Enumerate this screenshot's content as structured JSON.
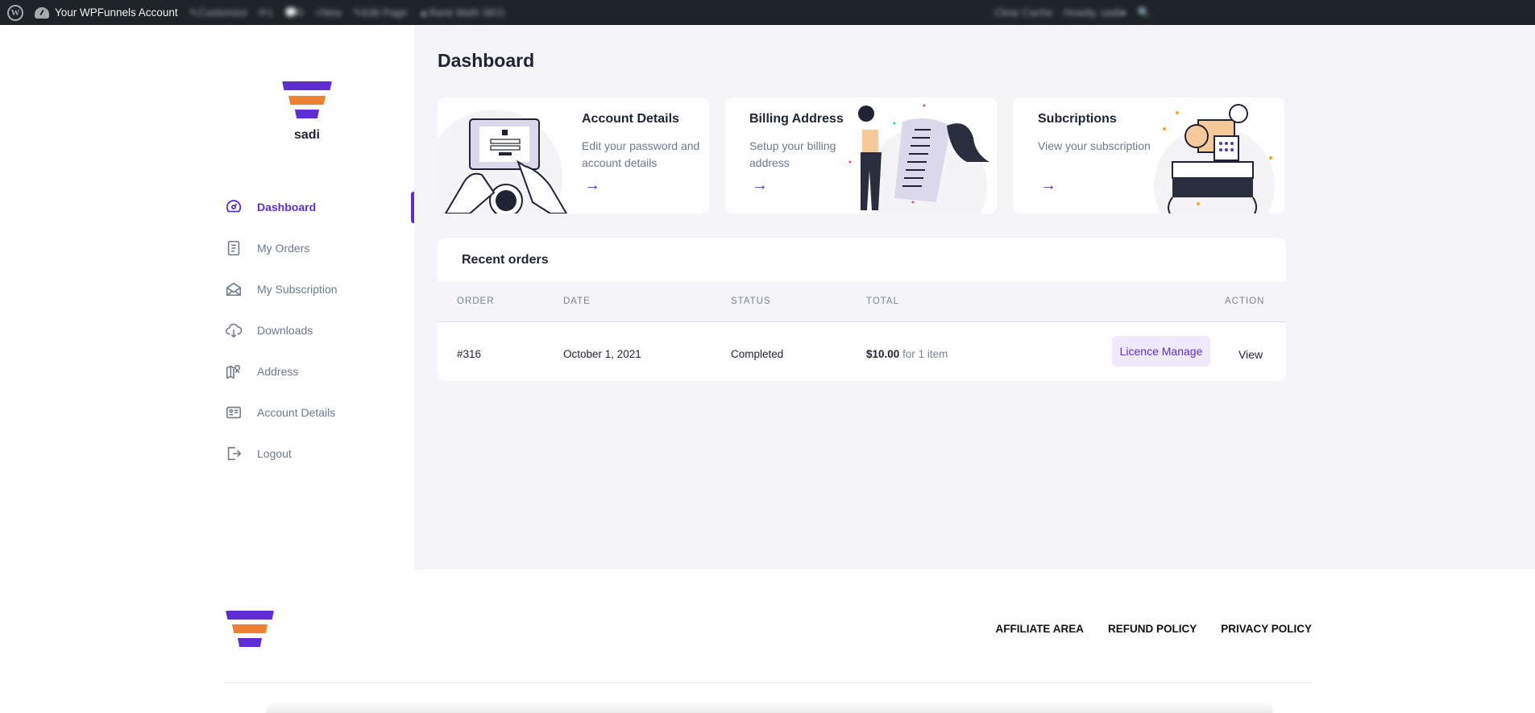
{
  "adminbar": {
    "site_name": "Your WPFunnels Account",
    "items_blurred": [
      "Customize",
      "1",
      "0",
      "New",
      "Edit Page",
      "Rank Math SEO"
    ],
    "right_items_blurred": [
      "Clear Cache",
      "Howdy, sadi"
    ]
  },
  "sidebar": {
    "username": "sadi",
    "items": [
      {
        "label": "Dashboard",
        "icon": "dashboard-gauge-icon",
        "active": true
      },
      {
        "label": "My Orders",
        "icon": "document-icon",
        "active": false
      },
      {
        "label": "My Subscription",
        "icon": "envelope-open-icon",
        "active": false
      },
      {
        "label": "Downloads",
        "icon": "cloud-download-icon",
        "active": false
      },
      {
        "label": "Address",
        "icon": "map-pin-icon",
        "active": false
      },
      {
        "label": "Account Details",
        "icon": "id-card-icon",
        "active": false
      },
      {
        "label": "Logout",
        "icon": "logout-icon",
        "active": false
      }
    ]
  },
  "main": {
    "title": "Dashboard",
    "cards": [
      {
        "title": "Account Details",
        "description": "Edit your password and account details",
        "arrow": "→"
      },
      {
        "title": "Billing Address",
        "description": "Setup your billing address",
        "arrow": "→"
      },
      {
        "title": "Subcriptions",
        "description": "View your subscription",
        "arrow": "→"
      }
    ],
    "recent_orders": {
      "heading": "Recent orders",
      "columns": [
        "ORDER",
        "DATE",
        "STATUS",
        "TOTAL",
        "ACTION"
      ],
      "rows": [
        {
          "order": "#316",
          "date": "October 1, 2021",
          "status": "Completed",
          "total_amount": "$10.00",
          "total_suffix": "for 1 item",
          "action_primary": "Licence Manage",
          "action_secondary": "View"
        }
      ]
    }
  },
  "footer": {
    "links": [
      "AFFILIATE AREA",
      "REFUND POLICY",
      "PRIVACY POLICY"
    ]
  },
  "colors": {
    "accent": "#5f2ed1",
    "brand_orange": "#ee8133",
    "admin_bar": "#1d2327",
    "main_bg": "#f5f5f8"
  }
}
